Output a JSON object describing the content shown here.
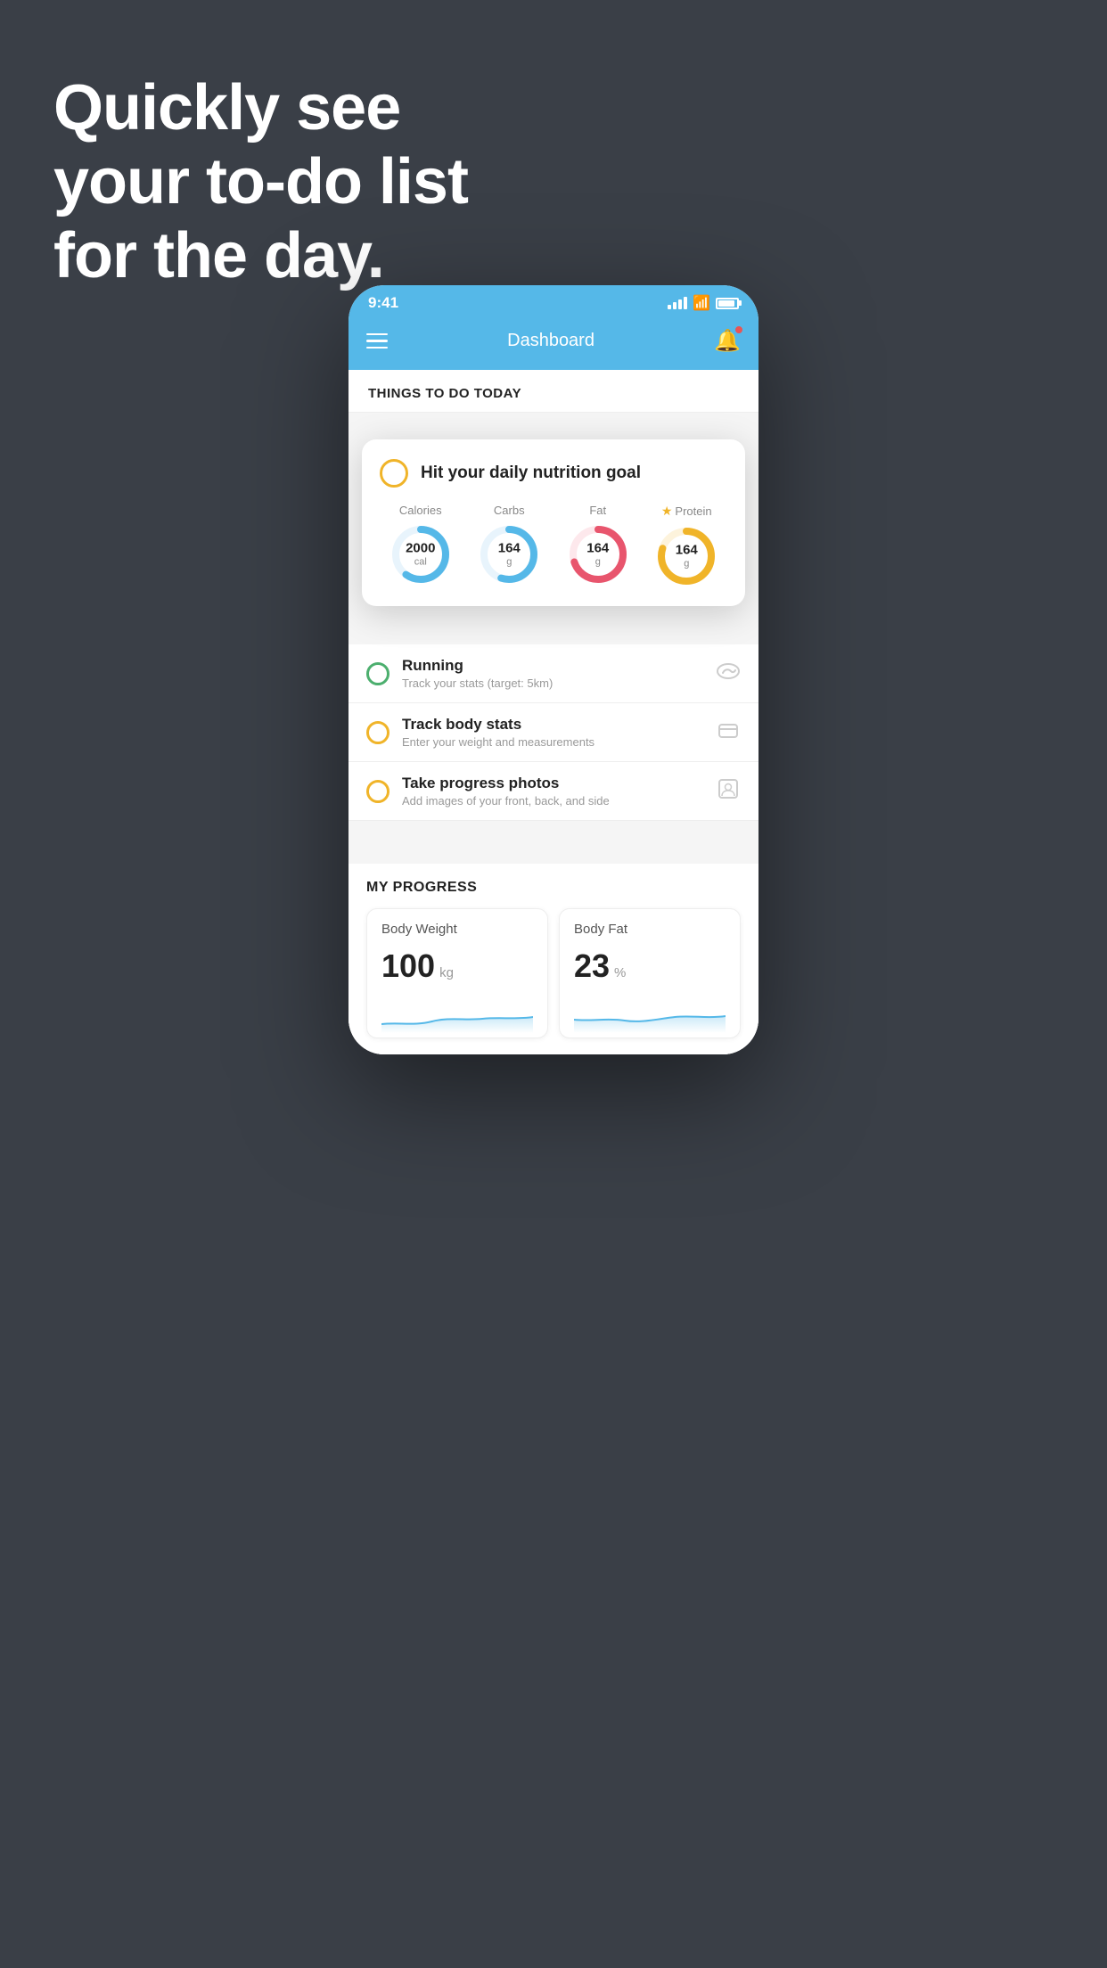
{
  "hero": {
    "line1": "Quickly see",
    "line2": "your to-do list",
    "line3": "for the day."
  },
  "status_bar": {
    "time": "9:41"
  },
  "header": {
    "title": "Dashboard"
  },
  "things_section": {
    "label": "THINGS TO DO TODAY"
  },
  "floating_card": {
    "title": "Hit your daily nutrition goal",
    "nutrition": [
      {
        "label": "Calories",
        "value": "2000",
        "unit": "cal",
        "color": "#55b8e8",
        "pct": 60,
        "star": false
      },
      {
        "label": "Carbs",
        "value": "164",
        "unit": "g",
        "color": "#55b8e8",
        "pct": 55,
        "star": false
      },
      {
        "label": "Fat",
        "value": "164",
        "unit": "g",
        "color": "#e8556d",
        "pct": 70,
        "star": false
      },
      {
        "label": "Protein",
        "value": "164",
        "unit": "g",
        "color": "#f0b429",
        "pct": 80,
        "star": true
      }
    ]
  },
  "todo_items": [
    {
      "type": "green",
      "title": "Running",
      "subtitle": "Track your stats (target: 5km)",
      "icon": "🏃"
    },
    {
      "type": "yellow",
      "title": "Track body stats",
      "subtitle": "Enter your weight and measurements",
      "icon": "⚖"
    },
    {
      "type": "yellow",
      "title": "Take progress photos",
      "subtitle": "Add images of your front, back, and side",
      "icon": "👤"
    }
  ],
  "progress": {
    "section_title": "MY PROGRESS",
    "cards": [
      {
        "title": "Body Weight",
        "value": "100",
        "unit": "kg"
      },
      {
        "title": "Body Fat",
        "value": "23",
        "unit": "%"
      }
    ]
  }
}
